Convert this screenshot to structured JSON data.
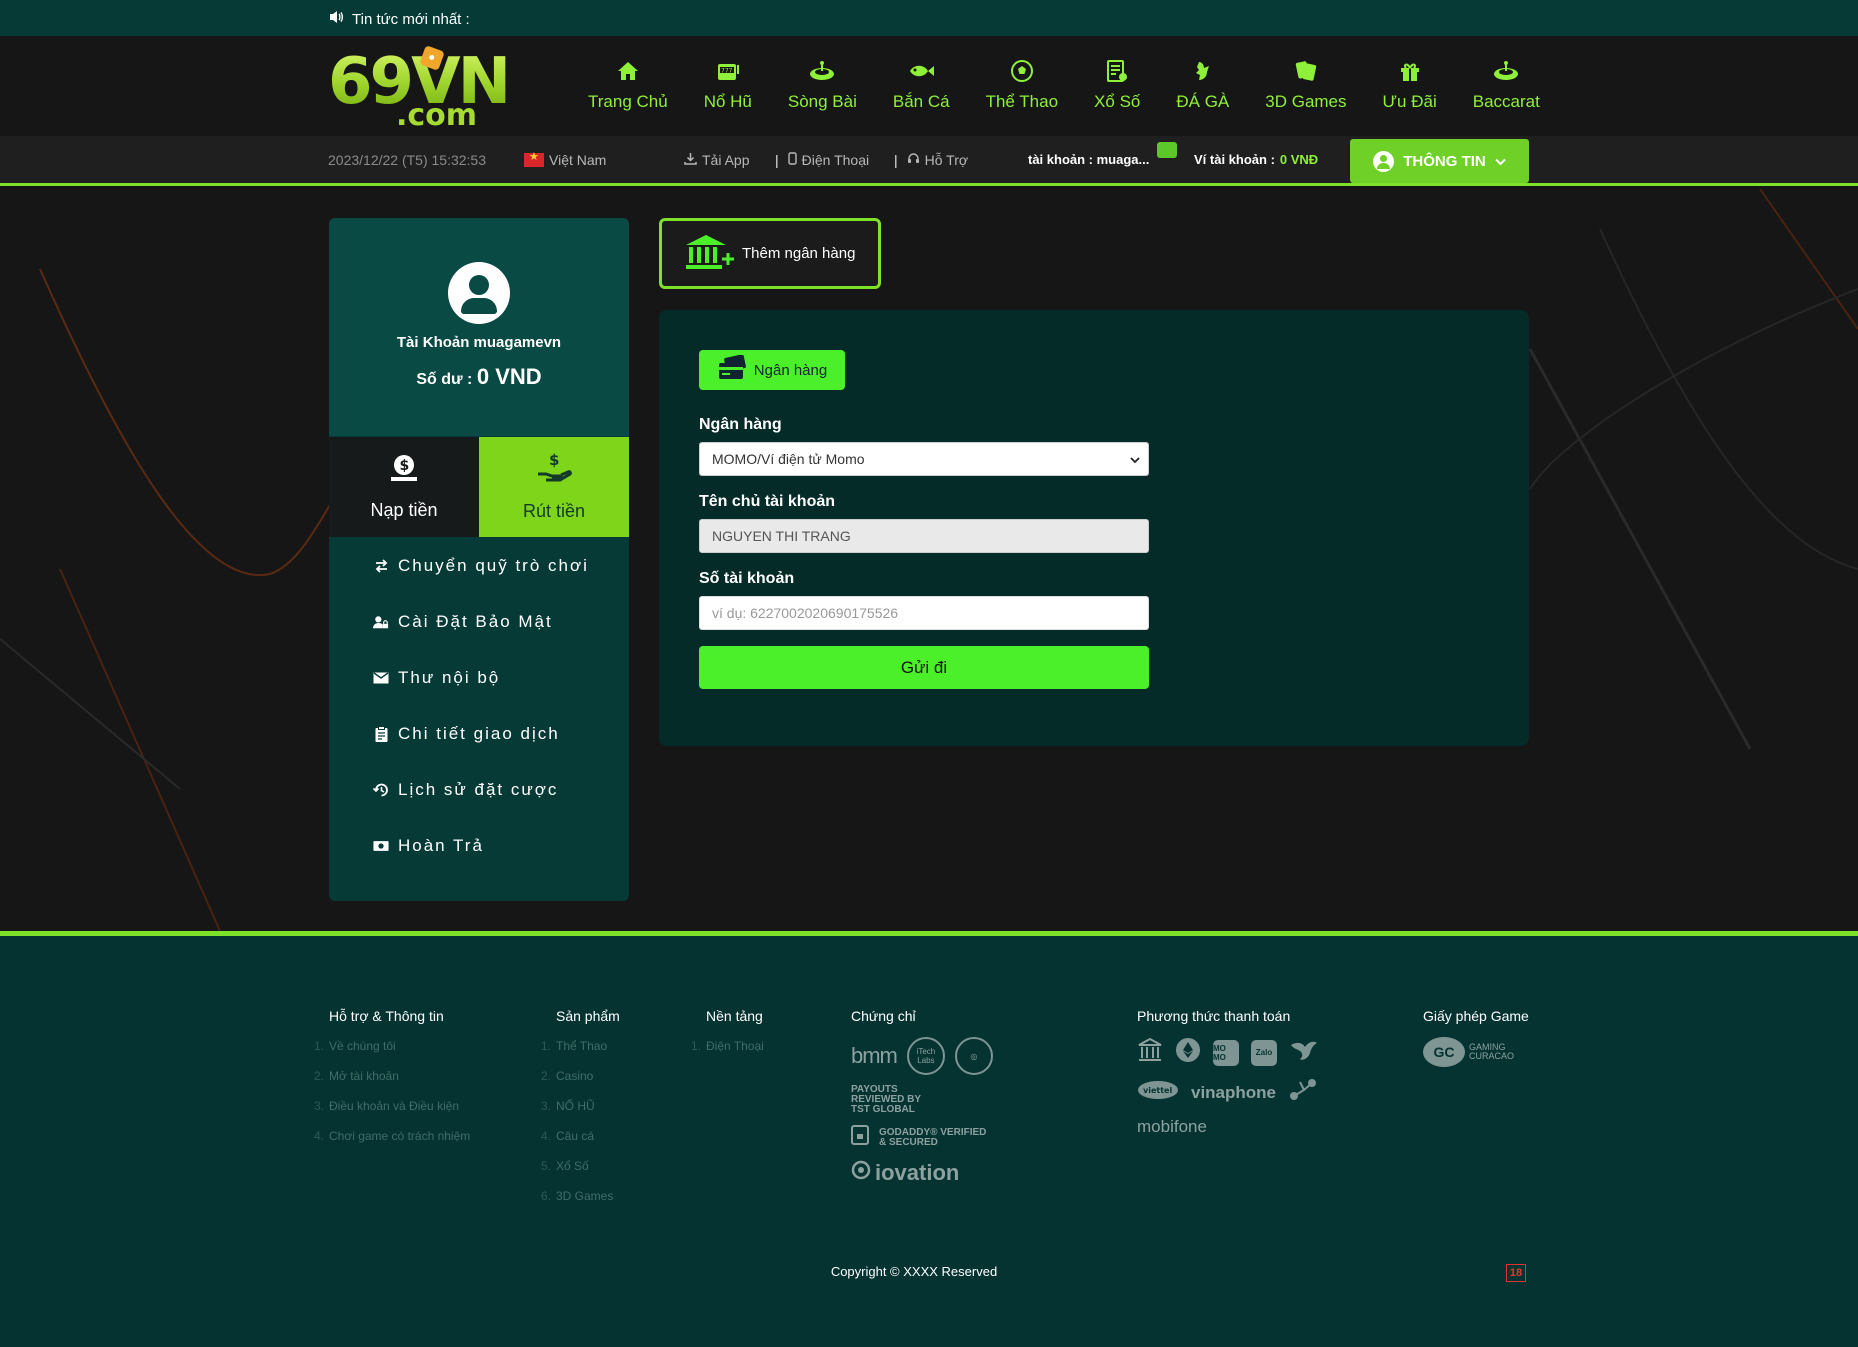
{
  "ticker": {
    "label": "Tin tức mới nhất :"
  },
  "logo": {
    "main": "69VN",
    "sub": ".com"
  },
  "nav": [
    {
      "label": "Trang Chủ",
      "icon": "home-icon"
    },
    {
      "label": "Nổ Hũ",
      "icon": "slot-machine-icon"
    },
    {
      "label": "Sòng Bài",
      "icon": "roulette-icon"
    },
    {
      "label": "Bắn Cá",
      "icon": "fish-icon"
    },
    {
      "label": "Thể Thao",
      "icon": "soccer-ball-icon"
    },
    {
      "label": "Xổ Số",
      "icon": "lottery-icon"
    },
    {
      "label": "ĐÁ GÀ",
      "icon": "rooster-icon"
    },
    {
      "label": "3D Games",
      "icon": "cards-icon"
    },
    {
      "label": "Ưu Đãi",
      "icon": "gift-icon"
    },
    {
      "label": "Baccarat",
      "icon": "baccarat-icon"
    }
  ],
  "subbar": {
    "datetime": "2023/12/22 (T5) 15:32:53",
    "language": "Việt Nam",
    "app": "Tải App",
    "phone": "Điện Thoại",
    "support": "Hỗ Trợ",
    "account": "tài khoản : muaga...",
    "wallet_label": "Ví tài khoản :",
    "wallet_value": "0 VNĐ",
    "info_button": "THÔNG TIN"
  },
  "profile": {
    "name": "Tài Khoản muagamevn",
    "balance_label": "Số dư :",
    "balance_value": "0 VND"
  },
  "tabs": {
    "deposit": "Nạp tiền",
    "withdraw": "Rút tiền"
  },
  "menu": [
    {
      "label": "Chuyển quỹ trò chơi",
      "icon": "transfer-icon"
    },
    {
      "label": "Cài Đặt Bảo Mật",
      "icon": "user-lock-icon"
    },
    {
      "label": "Thư nội bộ",
      "icon": "envelope-icon"
    },
    {
      "label": "Chi tiết giao dịch",
      "icon": "clipboard-icon"
    },
    {
      "label": "Lịch sử đặt cược",
      "icon": "history-icon"
    },
    {
      "label": "Hoàn Trả",
      "icon": "money-icon"
    }
  ],
  "add_bank": "Thêm ngân hàng",
  "form": {
    "tab": "Ngân hàng",
    "bank_label": "Ngân hàng",
    "bank_value": "MOMO/Ví điện tử Momo",
    "owner_label": "Tên chủ tài khoản",
    "owner_value": "NGUYEN THI TRANG",
    "account_label": "Số tài khoản",
    "account_placeholder": "ví dụ:  6227002020690175526",
    "submit": "Gửi đi"
  },
  "footer": {
    "support_title": "Hỗ trợ & Thông tin",
    "support_items": [
      "Về chúng tôi",
      "Mở tài khoản",
      "Điều khoản và Điều kiện",
      "Chơi game có trách nhiệm"
    ],
    "products_title": "Sản phẩm",
    "products_items": [
      "Thể Thao",
      "Casino",
      "NỔ HŨ",
      "Câu cá",
      "Xổ Số",
      "3D Games"
    ],
    "platform_title": "Nền tảng",
    "platform_items": [
      "Điện Thoại"
    ],
    "cert_title": "Chứng chỉ",
    "cert_bmm": "bmm",
    "cert_itech": "iTech Labs",
    "cert_tst": "PAYOUTS REVIEWED BY TST GLOBAL",
    "cert_godaddy": "GODADDY® VERIFIED & SECURED",
    "cert_iovation": "iovation",
    "payment_title": "Phương thức thanh toán",
    "pay_momo": "MO MO",
    "pay_zalo": "Zalo",
    "pay_viettel": "viettel",
    "pay_vinaphone": "vinaphone",
    "pay_mobifone": "mobifone",
    "license_title": "Giấy phép Game",
    "license_badge": "GC",
    "license_text": "GAMING CURACAO",
    "copyright": "Copyright © XXXX Reserved",
    "age": "18"
  },
  "colors": {
    "accent": "#7fe22a",
    "nav_text": "#8ff03a",
    "panel": "#063a36",
    "button": "#4cf02a"
  }
}
